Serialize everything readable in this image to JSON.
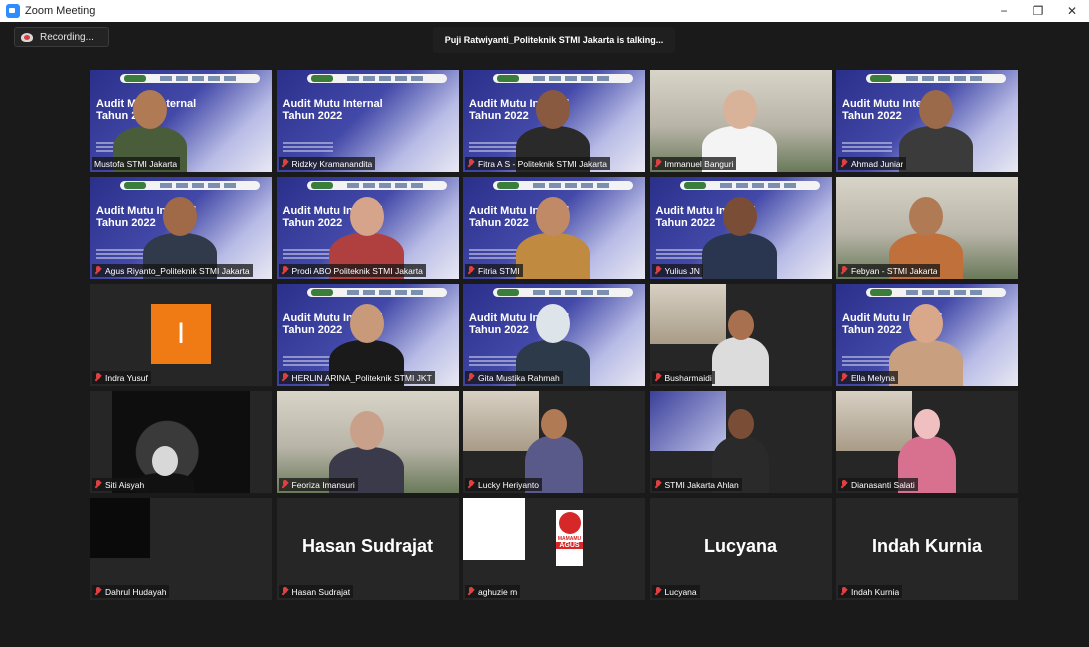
{
  "window": {
    "title": "Zoom Meeting",
    "controls": {
      "minimize": "−",
      "restore": "❐",
      "close": "✕"
    }
  },
  "recording": {
    "label": "Recording..."
  },
  "talking_banner": {
    "text": "Puji Ratwiyanti_Politeknik STMI Jakarta is talking..."
  },
  "slide": {
    "title_line1": "Audit Mutu Internal",
    "title_line2": "Tahun 2022"
  },
  "participants": [
    {
      "name": "Mustofa STMI Jakarta",
      "muted": false,
      "view": "slide-person",
      "skin": "#b07a55",
      "shirt": "#4a5d3a"
    },
    {
      "name": "Ridzky Kramanandita",
      "muted": true,
      "view": "slide",
      "skin": "",
      "shirt": ""
    },
    {
      "name": "Fitra A S - Politeknik STMI Jakarta",
      "muted": true,
      "view": "slide-person",
      "skin": "#8a5a40",
      "shirt": "#2a2a2a"
    },
    {
      "name": "Immanuel Banguri",
      "muted": true,
      "view": "camera",
      "skin": "#d9b29a",
      "shirt": "#f4f4f4"
    },
    {
      "name": "Ahmad Juniar",
      "muted": true,
      "view": "slide-person",
      "skin": "#9a6a4a",
      "shirt": "#3b3b3b"
    },
    {
      "name": "Agus Riyanto_Politeknik STMI Jakarta",
      "muted": true,
      "view": "slide-person",
      "skin": "#a06a48",
      "shirt": "#303a4a"
    },
    {
      "name": "Prodi ABO Politeknik STMI Jakarta",
      "muted": true,
      "view": "slide-person",
      "skin": "#d5a48a",
      "shirt": "#b04040"
    },
    {
      "name": "Fitria STMI",
      "muted": true,
      "view": "slide-person",
      "skin": "#c08a66",
      "shirt": "#c08a40"
    },
    {
      "name": "Yulius JN",
      "muted": true,
      "view": "slide-person",
      "skin": "#7a4e36",
      "shirt": "#2a3550"
    },
    {
      "name": "Febyan - STMI Jakarta",
      "muted": true,
      "view": "camera",
      "skin": "#b07a55",
      "shirt": "#c0703a"
    },
    {
      "name": "Indra Yusuf",
      "muted": true,
      "view": "avatar",
      "avatar_letter": "I",
      "avatar_color": "#f07a13"
    },
    {
      "name": "HERLIN ARINA_Politeknik STMI JKT",
      "muted": true,
      "view": "slide-person",
      "skin": "#c89a7a",
      "shirt": "#1a1a1a"
    },
    {
      "name": "Gita Mustika Rahmah",
      "muted": true,
      "view": "slide-person",
      "skin": "#dde4ea",
      "shirt": "#2d3a4a"
    },
    {
      "name": "Busharmaidi",
      "muted": true,
      "view": "small-photo",
      "skin": "#a8704e",
      "shirt": "#dcdcdc"
    },
    {
      "name": "Ella Melyna",
      "muted": true,
      "view": "slide-person",
      "skin": "#d9a88a",
      "shirt": "#c8a080"
    },
    {
      "name": "Siti Aisyah",
      "muted": true,
      "view": "car",
      "skin": "#d8d8d8",
      "shirt": "#111111"
    },
    {
      "name": "Feoriza Imansuri",
      "muted": true,
      "view": "camera",
      "skin": "#c9a08a",
      "shirt": "#3a3a4a"
    },
    {
      "name": "Lucky Heriyanto",
      "muted": true,
      "view": "small-photo",
      "skin": "#b07a55",
      "shirt": "#5a5a8a"
    },
    {
      "name": "STMI Jakarta Ahlan",
      "muted": true,
      "view": "small-slide",
      "skin": "#7a4e36",
      "shirt": "#2a2a2a"
    },
    {
      "name": "Dianasanti Salati",
      "muted": true,
      "view": "small-photo",
      "skin": "#f0c0c0",
      "shirt": "#d87090"
    },
    {
      "name": "Dahrul Hudayah",
      "muted": true,
      "view": "dark-square"
    },
    {
      "name": "Hasan Sudrajat",
      "muted": true,
      "view": "text-name",
      "display": "Hasan Sudrajat"
    },
    {
      "name": "aghuzie m",
      "muted": true,
      "view": "logo-photo",
      "logo_text_top": "MAMAMU",
      "logo_text_bottom": "AGUS"
    },
    {
      "name": "Lucyana",
      "muted": true,
      "view": "text-name",
      "display": "Lucyana"
    },
    {
      "name": "Indah Kurnia",
      "muted": true,
      "view": "text-name",
      "display": "Indah Kurnia"
    }
  ]
}
